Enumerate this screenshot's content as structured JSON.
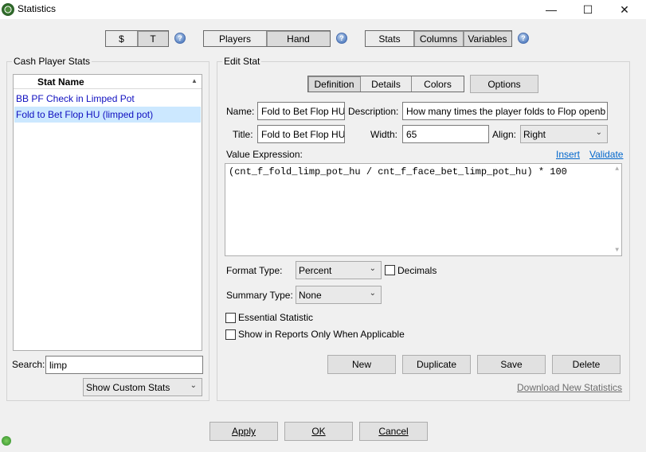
{
  "window": {
    "title": "Statistics",
    "minimize": "—",
    "maximize": "☐",
    "close": "✕"
  },
  "toolbar": {
    "currency": [
      "$",
      "T"
    ],
    "view": [
      "Players",
      "Hand"
    ],
    "section": [
      "Stats",
      "Columns",
      "Variables"
    ],
    "help": "?"
  },
  "left_panel": {
    "group_title": "Cash Player Stats",
    "column_header": "Stat Name",
    "items": [
      {
        "label": "BB PF Check in Limped Pot"
      },
      {
        "label": "Fold to Bet Flop HU (limped pot)"
      }
    ],
    "search_label": "Search:",
    "search_value": "limp",
    "filter_value": "Show Custom Stats"
  },
  "edit_stat": {
    "group_title": "Edit Stat",
    "tabs": [
      "Definition",
      "Details",
      "Colors"
    ],
    "options_label": "Options",
    "name_label": "Name:",
    "name_value": "Fold to Bet Flop HU",
    "description_label": "Description:",
    "description_value": "How many times the player folds to Flop openb",
    "title_label": "Title:",
    "title_value": "Fold to Bet Flop HU",
    "width_label": "Width:",
    "width_value": "65",
    "align_label": "Align:",
    "align_value": "Right",
    "value_expression_label": "Value Expression:",
    "insert_label": "Insert",
    "validate_label": "Validate",
    "expression": "(cnt_f_fold_limp_pot_hu / cnt_f_face_bet_limp_pot_hu) * 100",
    "format_type_label": "Format Type:",
    "format_type_value": "Percent",
    "decimals_label": "Decimals",
    "summary_type_label": "Summary Type:",
    "summary_type_value": "None",
    "essential_label": "Essential Statistic",
    "reports_only_label": "Show in Reports Only When Applicable",
    "new_label": "New",
    "duplicate_label": "Duplicate",
    "save_label": "Save",
    "delete_label": "Delete",
    "download_label": "Download New Statistics"
  },
  "footer": {
    "apply_label": "Apply",
    "ok_label": "OK",
    "cancel_label": "Cancel"
  }
}
